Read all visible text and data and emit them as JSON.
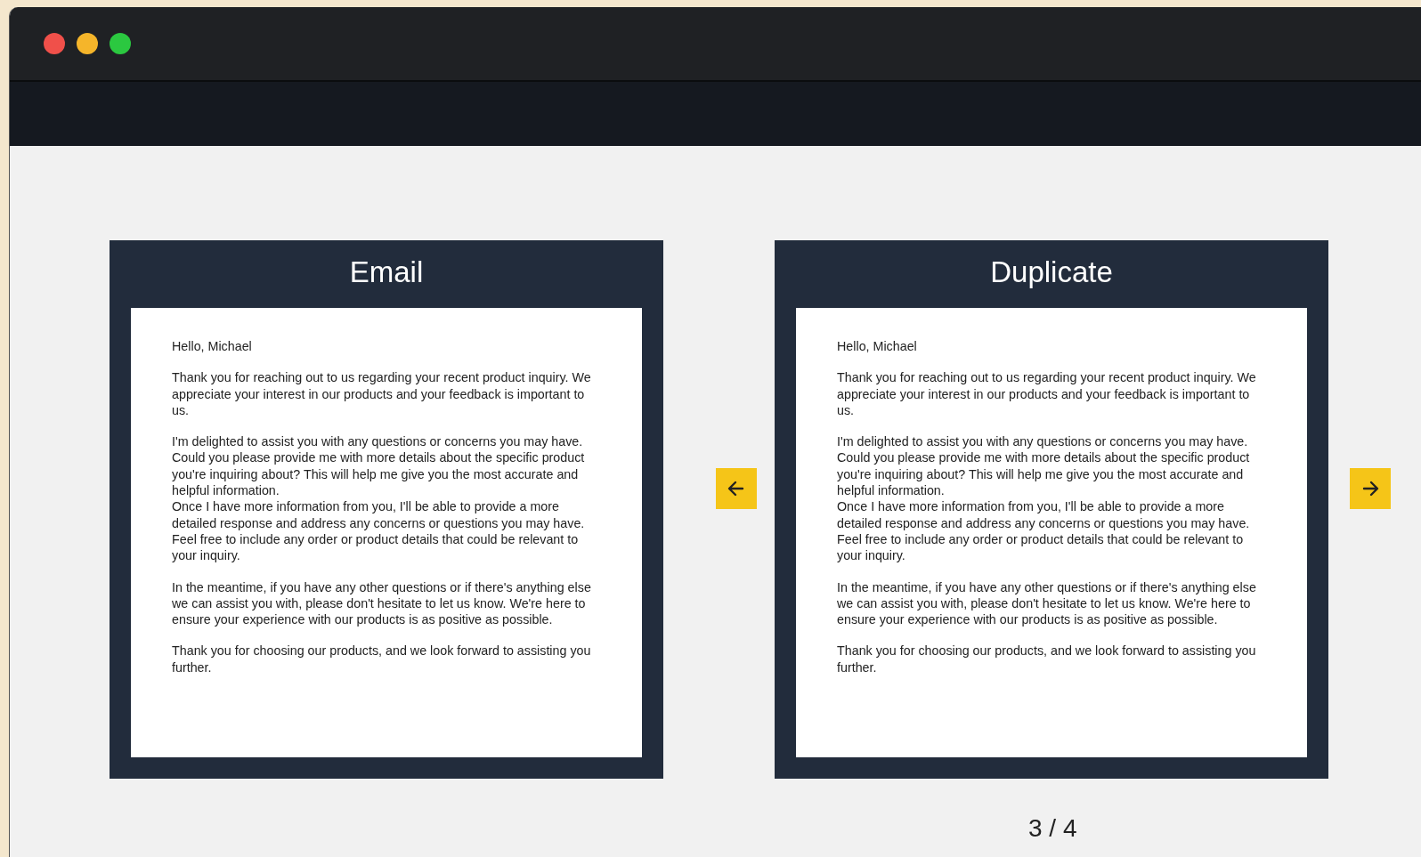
{
  "window": {
    "controls": [
      {
        "color": "#f0504a"
      },
      {
        "color": "#f5b52a"
      },
      {
        "color": "#2bc840"
      }
    ]
  },
  "cards": [
    {
      "title": "Email",
      "blocks": [
        [
          "Hello, Michael"
        ],
        [
          "Thank you for reaching out to us regarding your recent product inquiry. We appreciate your interest in our products and your feedback is important to us."
        ],
        [
          "I'm delighted to assist you with any questions or concerns you may have. Could you please provide me with more details about the specific product you're inquiring about? This will help me give you the most accurate and helpful information.",
          "Once I have more information from you, I'll be able to provide a more detailed response and address any concerns or questions you may have. Feel free to include any order or product details that could be relevant to your inquiry."
        ],
        [
          "In the meantime, if you have any other questions or if there's anything else we can assist you with, please don't hesitate to let us know. We're here to ensure your experience with our products is as positive as possible."
        ],
        [
          "Thank you for choosing our products, and we look forward to assisting you further."
        ]
      ]
    },
    {
      "title": "Duplicate",
      "blocks": [
        [
          "Hello, Michael"
        ],
        [
          "Thank you for reaching out to us regarding your recent product inquiry. We appreciate your interest in our products and your feedback is important to us."
        ],
        [
          "I'm delighted to assist you with any questions or concerns you may have. Could you please provide me with more details about the specific product you're inquiring about? This will help me give you the most accurate and helpful information.",
          "Once I have more information from you, I'll be able to provide a more detailed response and address any concerns or questions you may have. Feel free to include any order or product details that could be relevant to your inquiry."
        ],
        [
          "In the meantime, if you have any other questions or if there's anything else we can assist you with, please don't hesitate to let us know. We're here to ensure your experience with our products is as positive as possible."
        ],
        [
          "Thank you for choosing our products, and we look forward to assisting you further."
        ]
      ]
    }
  ],
  "pager": {
    "label": "3 / 4"
  }
}
